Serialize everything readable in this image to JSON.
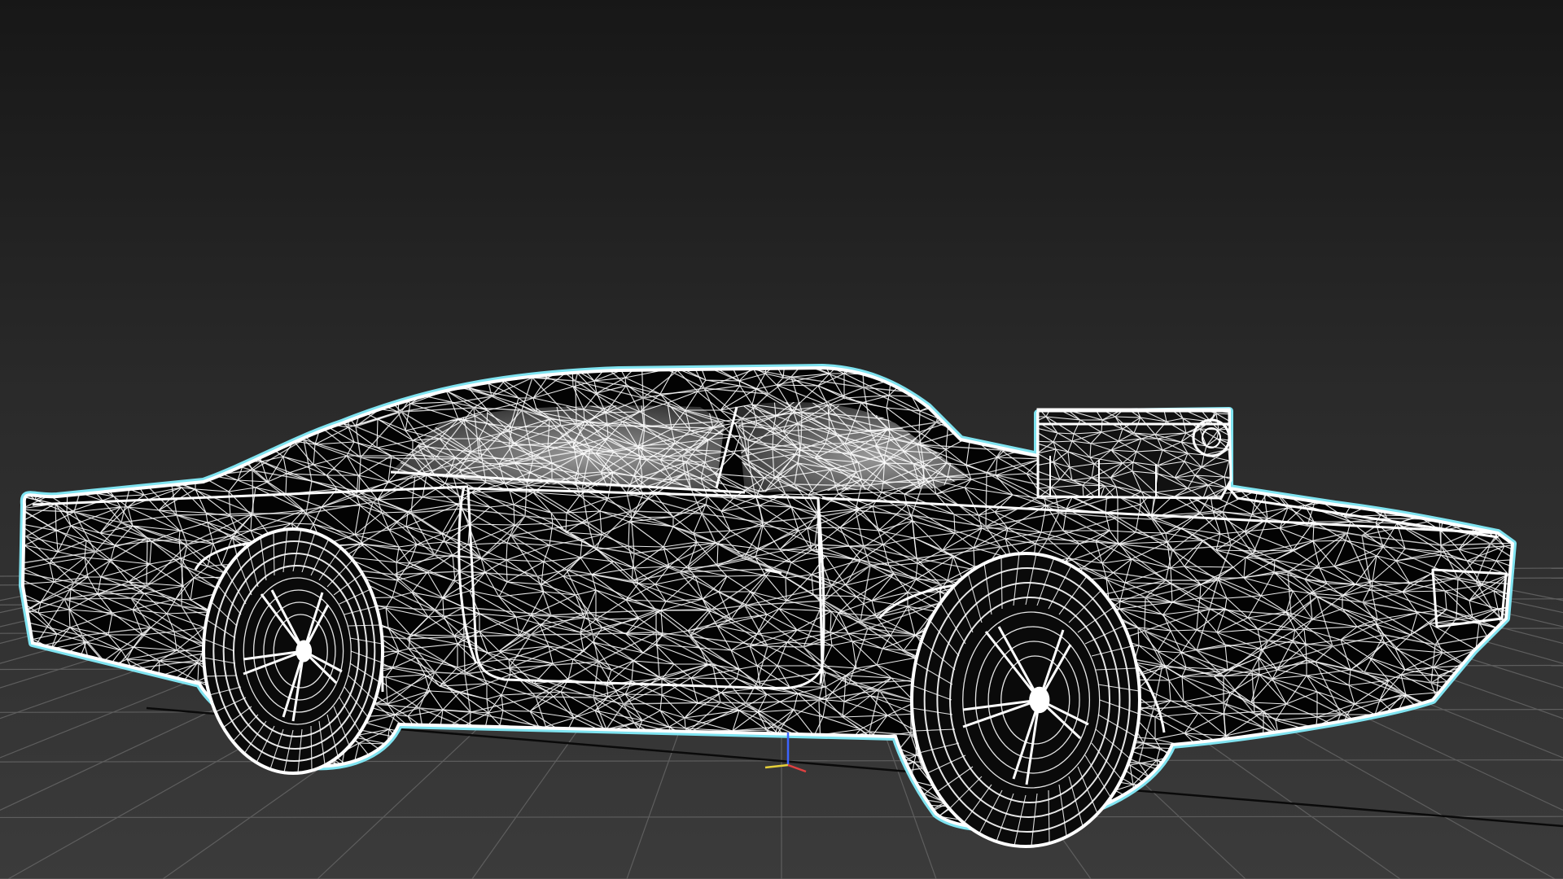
{
  "viewport": {
    "background_top": "#171717",
    "background_bottom": "#3b3b3b",
    "grid_color": "#5e5e5e",
    "grid_axis_color": "#0a0a0a",
    "wire_color": "#ffffff",
    "selection_outline_color": "#7fe3f0",
    "body_fill": "#030303",
    "glass_fill": "#6a6a6a"
  },
  "scene_object": {
    "type": "car-wireframe",
    "selected": true
  },
  "gizmo": {
    "axes": [
      {
        "name": "x",
        "color": "#e04040"
      },
      {
        "name": "y",
        "color": "#e6d03a"
      },
      {
        "name": "z",
        "color": "#3c64ff"
      }
    ]
  }
}
